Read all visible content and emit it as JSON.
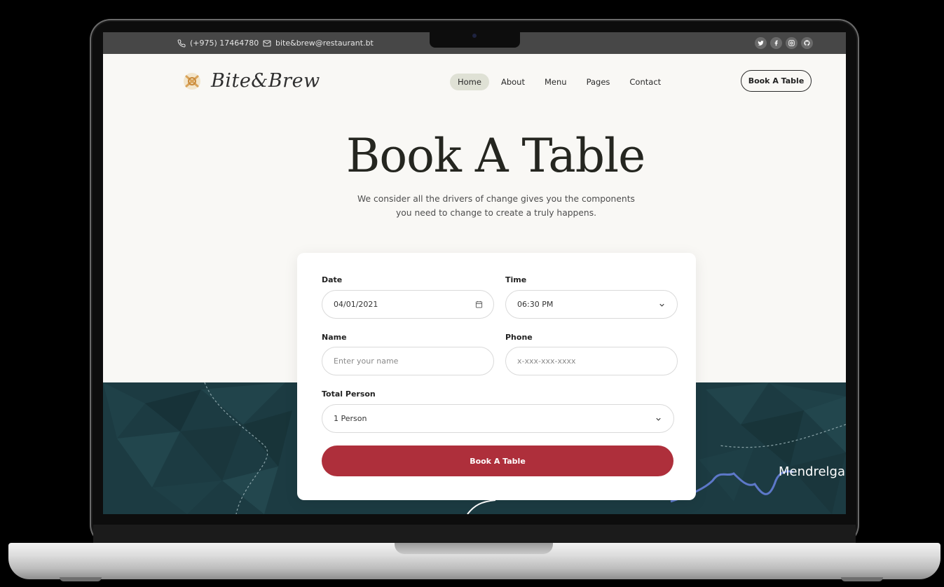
{
  "topbar": {
    "phone": "(+975) 17464780",
    "email": "bite&brew@restaurant.bt",
    "socials": [
      "twitter-icon",
      "facebook-icon",
      "instagram-icon",
      "github-icon"
    ]
  },
  "brand": {
    "name": "Bite&Brew"
  },
  "nav": {
    "items": [
      "Home",
      "About",
      "Menu",
      "Pages",
      "Contact"
    ],
    "active": "Home",
    "cta": "Book A Table"
  },
  "hero": {
    "title": "Book A Table",
    "subtitle_line1": "We consider all the drivers of change gives you the components",
    "subtitle_line2": "you need to change to create a truly happens."
  },
  "form": {
    "date_label": "Date",
    "date_value": "04/01/2021",
    "time_label": "Time",
    "time_value": "06:30 PM",
    "name_label": "Name",
    "name_placeholder": "Enter your name",
    "phone_label": "Phone",
    "phone_placeholder": "x-xxx-xxx-xxxx",
    "persons_label": "Total Person",
    "persons_value": "1 Person",
    "submit": "Book A Table"
  },
  "map": {
    "place_label": "Mendrelga"
  },
  "colors": {
    "accent": "#ae2f3b",
    "nav_active_bg": "#dfe1d5",
    "map_bg": "#1c3b42"
  }
}
